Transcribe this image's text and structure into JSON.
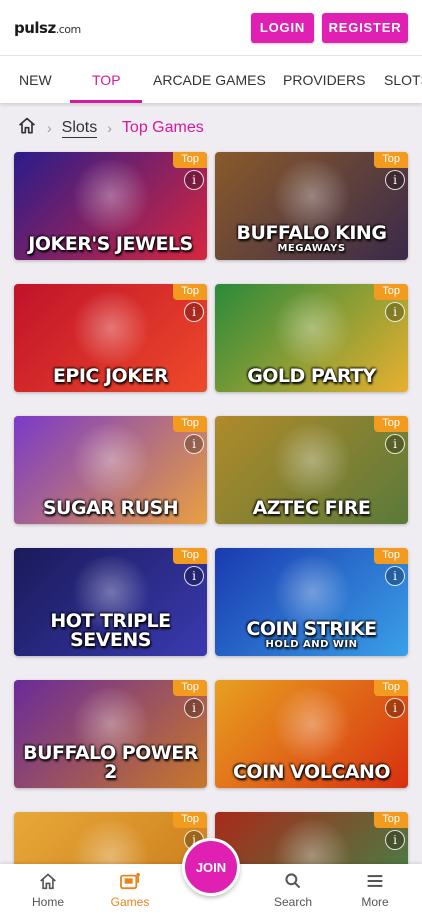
{
  "header": {
    "logo_main": "pulsz",
    "logo_suffix": ".com",
    "login_label": "LOGIN",
    "register_label": "REGISTER"
  },
  "tabs": [
    {
      "label": "NEW"
    },
    {
      "label": "TOP",
      "active": true
    },
    {
      "label": "ARCADE GAMES"
    },
    {
      "label": "PROVIDERS"
    },
    {
      "label": "SLOTS"
    }
  ],
  "breadcrumb": {
    "home_icon": "home-icon",
    "slots": "Slots",
    "current": "Top Games"
  },
  "games": [
    {
      "title": "JOKER'S JEWELS",
      "subtitle": "",
      "badge": "Top",
      "colors": [
        "#2a1c8a",
        "#d8263f"
      ]
    },
    {
      "title": "BUFFALO KING",
      "subtitle": "MEGAWAYS",
      "badge": "Top",
      "colors": [
        "#8a5a2a",
        "#3a2a4a"
      ]
    },
    {
      "title": "EPIC JOKER",
      "subtitle": "",
      "badge": "Top",
      "colors": [
        "#c0122a",
        "#ef4a2a"
      ]
    },
    {
      "title": "GOLD PARTY",
      "subtitle": "",
      "badge": "Top",
      "colors": [
        "#2a8a3a",
        "#e8b030"
      ]
    },
    {
      "title": "SUGAR RUSH",
      "subtitle": "",
      "badge": "Top",
      "colors": [
        "#7a3ac8",
        "#e8a040"
      ]
    },
    {
      "title": "AZTEC FIRE",
      "subtitle": "",
      "badge": "Top",
      "colors": [
        "#b08a2a",
        "#5a7a3a"
      ]
    },
    {
      "title": "HOT TRIPLE SEVENS",
      "subtitle": "",
      "badge": "Top",
      "colors": [
        "#1a1a5a",
        "#3a3ab0"
      ]
    },
    {
      "title": "COIN STRIKE",
      "subtitle": "HOLD AND WIN",
      "badge": "Top",
      "colors": [
        "#1a3ab0",
        "#3aa0e8"
      ]
    },
    {
      "title": "BUFFALO POWER 2",
      "subtitle": "",
      "badge": "Top",
      "colors": [
        "#6a2a9a",
        "#c8782a"
      ]
    },
    {
      "title": "COIN VOLCANO",
      "subtitle": "",
      "badge": "Top",
      "colors": [
        "#e8a020",
        "#d83010"
      ]
    },
    {
      "title": "",
      "subtitle": "",
      "badge": "Top",
      "colors": [
        "#e8a838",
        "#c87818"
      ]
    },
    {
      "title": "",
      "subtitle": "",
      "badge": "Top",
      "colors": [
        "#a82a1a",
        "#3a8a4a"
      ]
    }
  ],
  "bottom_nav": {
    "home": "Home",
    "games": "Games",
    "join": "JOIN",
    "search": "Search",
    "more": "More"
  },
  "colors": {
    "brand": "#e01fb3",
    "accent_text": "#d6199e",
    "badge": "#f39b1f",
    "active_nav": "#e8841a"
  }
}
